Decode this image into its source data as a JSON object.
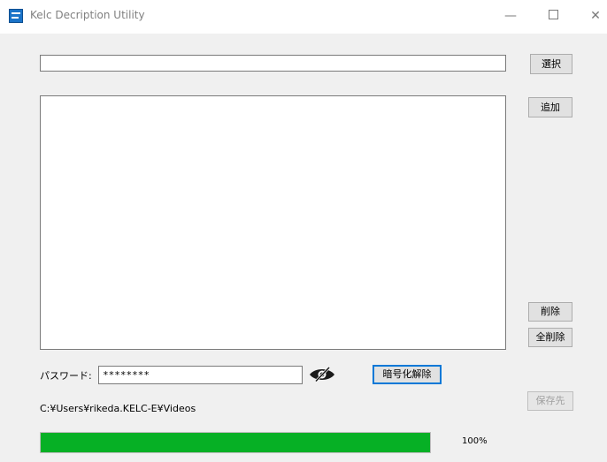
{
  "window": {
    "title": "Kelc Decription Utility",
    "minimize": "—",
    "close": "✕"
  },
  "form": {
    "file_path_value": "",
    "select_button": "選択",
    "add_button": "追加",
    "delete_button": "削除",
    "delete_all_button": "全削除",
    "password_label": "パスワード:",
    "password_value": "********",
    "decrypt_button": "暗号化解除",
    "save_button": "保存先",
    "output_path": "C:¥Users¥rikeda.KELC-E¥Videos",
    "progress_percent": 100,
    "progress_text": "100%"
  },
  "file_list": [],
  "colors": {
    "progress_fill": "#06b025",
    "focus_border": "#0078d7",
    "app_icon": "#1a73c8"
  },
  "icons": {
    "app": "app-icon",
    "password_toggle": "eye-slash-icon"
  }
}
